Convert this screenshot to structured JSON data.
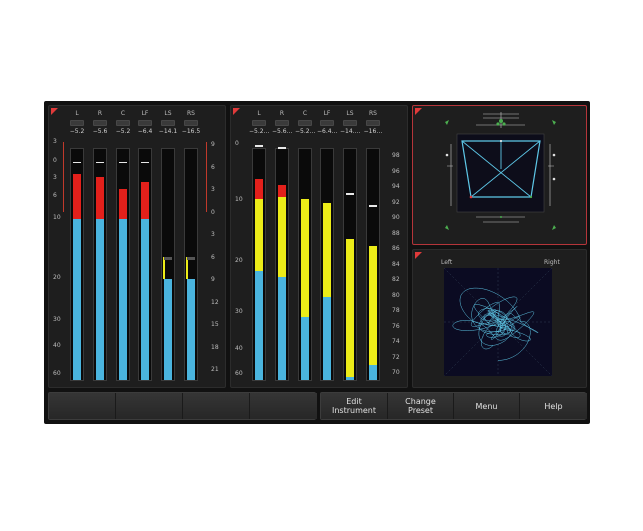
{
  "meter_panel_1": {
    "channels": [
      {
        "label": "L",
        "value": "−5.2",
        "level_db": 10,
        "peak_db": 3
      },
      {
        "label": "R",
        "value": "−5.6",
        "level_db": 10,
        "peak_db": 4
      },
      {
        "label": "C",
        "value": "−5.2",
        "level_db": 10,
        "peak_db": 8
      },
      {
        "label": "LF",
        "value": "−6.4",
        "level_db": 10,
        "peak_db": 5.5
      },
      {
        "label": "LS",
        "value": "−14.1",
        "level_db": 20,
        "peak_db": 20
      },
      {
        "label": "RS",
        "value": "−16.5",
        "level_db": 20,
        "peak_db": 20
      }
    ],
    "left_scale": [
      "3",
      "0",
      "3",
      "6",
      "10",
      "20",
      "30",
      "40",
      "60"
    ],
    "right_scale": [
      "9",
      "6",
      "3",
      "0",
      "3",
      "6",
      "9",
      "12",
      "15",
      "18",
      "21"
    ]
  },
  "meter_panel_2": {
    "channels": [
      {
        "label": "L",
        "value": "−5.2…"
      },
      {
        "label": "R",
        "value": "−5.6…"
      },
      {
        "label": "C",
        "value": "−5.2…"
      },
      {
        "label": "LF",
        "value": "−6.4…"
      },
      {
        "label": "LS",
        "value": "−14.…"
      },
      {
        "label": "RS",
        "value": "−16…"
      }
    ],
    "left_scale": [
      "0",
      "10",
      "20",
      "30",
      "40",
      "60"
    ],
    "right_scale": [
      "98",
      "96",
      "94",
      "92",
      "90",
      "88",
      "86",
      "84",
      "82",
      "80",
      "78",
      "76",
      "74",
      "72",
      "70"
    ]
  },
  "vectorscope": {
    "left_label": "Left",
    "right_label": "Right"
  },
  "buttons": {
    "edit_instrument": "Edit\nInstrument",
    "change_preset": "Change\nPreset",
    "menu": "Menu",
    "help": "Help"
  },
  "colors": {
    "red": "#e3201b",
    "blue": "#4ab4de",
    "yellow": "#ecec18",
    "accent_border": "#b5353a",
    "scope_trace": "#5ec8e8"
  }
}
